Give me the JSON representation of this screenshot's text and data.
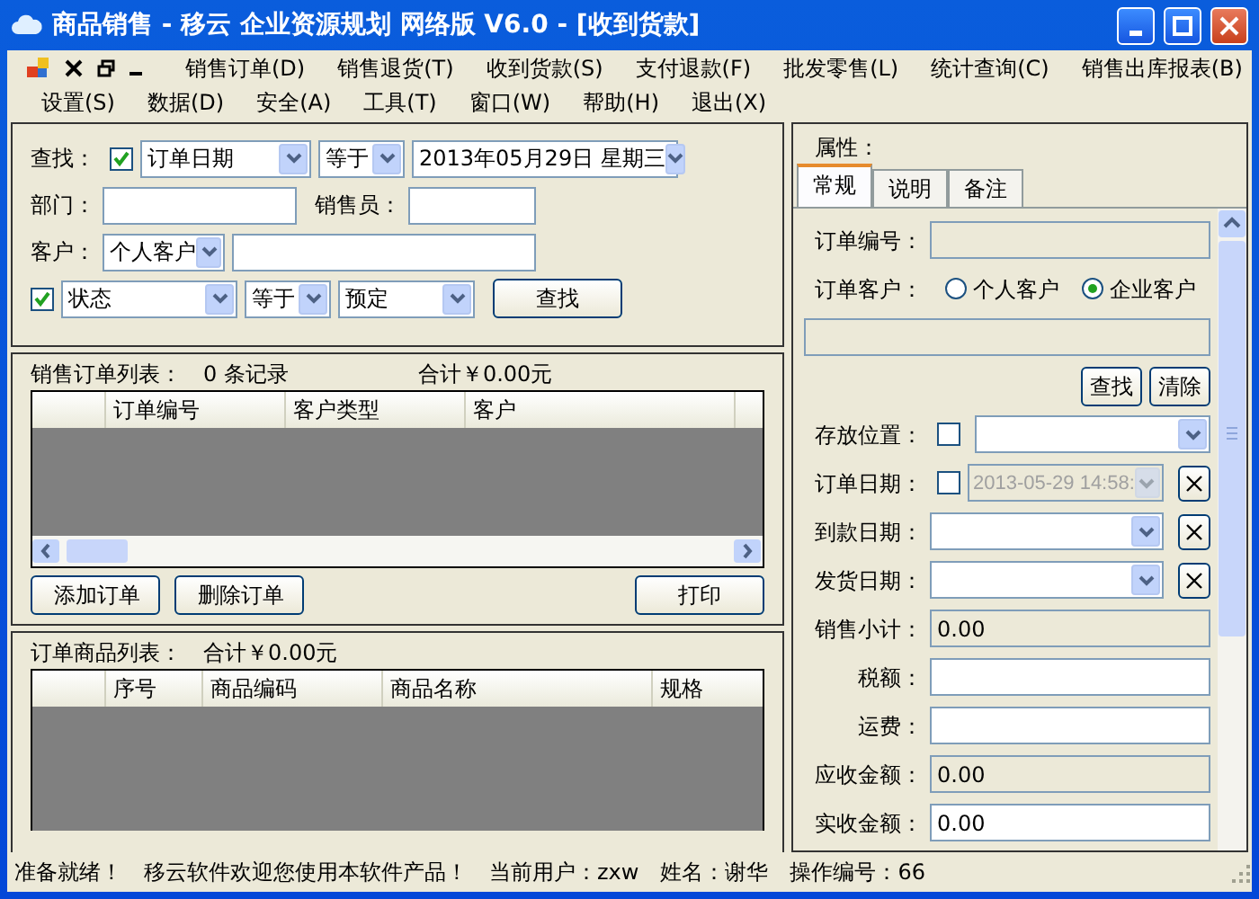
{
  "window": {
    "title": "商品销售 - 移云 企业资源规划 网络版 V6.0 - [收到货款]"
  },
  "menu_rows": [
    [
      "销售订单(D)",
      "销售退货(T)",
      "收到货款(S)",
      "支付退款(F)",
      "批发零售(L)",
      "统计查询(C)",
      "销售出库报表(B)"
    ],
    [
      "设置(S)",
      "数据(D)",
      "安全(A)",
      "工具(T)",
      "窗口(W)",
      "帮助(H)",
      "退出(X)"
    ]
  ],
  "search": {
    "label": "查找：",
    "date_checked": true,
    "field": "订单日期",
    "operator": "等于",
    "date": "2013年05月29日 星期三",
    "dept_label": "部门：",
    "salesperson_label": "销售员：",
    "customer_label": "客户：",
    "customer_type": "个人客户",
    "status_checked": true,
    "status_field": "状态",
    "status_operator": "等于",
    "status_value": "预定",
    "button": "查找"
  },
  "order_list": {
    "title": "销售订单列表：",
    "count": "0 条记录",
    "total": "合计￥0.00元",
    "columns": [
      "订单编号",
      "客户类型",
      "客户"
    ],
    "buttons": [
      "添加订单",
      "删除订单",
      "打印"
    ]
  },
  "goods_list": {
    "title": "订单商品列表：",
    "total": "合计￥0.00元",
    "columns": [
      "序号",
      "商品编码",
      "商品名称",
      "规格"
    ]
  },
  "properties": {
    "title": "属性：",
    "tabs": [
      {
        "label": "常规",
        "selected": true
      },
      {
        "label": "说明",
        "selected": false
      },
      {
        "label": "备注",
        "selected": false
      }
    ],
    "rows": [
      {
        "kind": "text",
        "label": "订单编号：",
        "readonly": true
      },
      {
        "kind": "radio",
        "label": "订单客户：",
        "options": [
          {
            "label": "个人客户",
            "selected": false
          },
          {
            "label": "企业客户",
            "selected": true
          }
        ]
      },
      {
        "kind": "wide",
        "readonly": true
      },
      {
        "kind": "buttons",
        "buttons": [
          "查找",
          "清除"
        ]
      },
      {
        "kind": "combo",
        "label": "存放位置：",
        "checked": false
      },
      {
        "kind": "date",
        "label": "订单日期：",
        "checked": false,
        "value": "2013-05-29 14:58:"
      },
      {
        "kind": "date",
        "label": "到款日期："
      },
      {
        "kind": "date",
        "label": "发货日期："
      },
      {
        "kind": "text",
        "label": "销售小计：",
        "readonly": true,
        "value": "0.00"
      },
      {
        "kind": "text",
        "label": "税额：",
        "readonly": false
      },
      {
        "kind": "text",
        "label": "运费：",
        "readonly": false
      },
      {
        "kind": "text",
        "label": "应收金额：",
        "readonly": true,
        "value": "0.00"
      },
      {
        "kind": "text",
        "label": "实收金额：",
        "readonly": false,
        "value": "0.00"
      }
    ]
  },
  "status_bar": [
    "准备就绪！",
    "移云软件欢迎您使用本软件产品！",
    "当前用户：zxw",
    "姓名：谢华",
    "操作编号：66"
  ]
}
